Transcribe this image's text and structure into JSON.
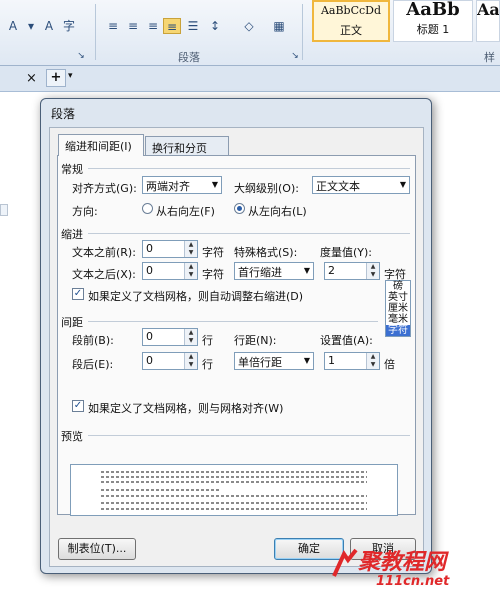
{
  "ribbon": {
    "paragraph_group_label": "段落",
    "style_gallery": [
      {
        "sample": "AaBbCcDd",
        "name": "正文",
        "active": true
      },
      {
        "sample": "AaBb",
        "name": "标题 1",
        "active": false
      },
      {
        "sample": "Aa",
        "name": "",
        "active": false
      }
    ],
    "styles_group_label": "样式"
  },
  "tabstrip": {
    "close": "×",
    "new_tab": "+"
  },
  "dialog": {
    "title": "段落",
    "tabs": [
      {
        "label": "缩进和间距(I)",
        "active": true
      },
      {
        "label": "换行和分页(P)",
        "active": false
      }
    ],
    "general": {
      "section_title": "常规",
      "alignment_label": "对齐方式(G):",
      "alignment_value": "两端对齐",
      "outline_label": "大纲级别(O):",
      "outline_value": "正文文本",
      "direction_label": "方向:",
      "direction_rtl": "从右向左(F)",
      "direction_ltr": "从左向右(L)"
    },
    "indent": {
      "section_title": "缩进",
      "before_label": "文本之前(R):",
      "before_value": "0",
      "before_unit": "字符",
      "after_label": "文本之后(X):",
      "after_value": "0",
      "after_unit": "字符",
      "special_label": "特殊格式(S):",
      "special_value": "首行缩进",
      "measure_label": "度量值(Y):",
      "measure_value": "2",
      "measure_unit": "字符",
      "grid_check_label": "如果定义了文档网格，则自动调整右缩进(D)"
    },
    "unit_options": [
      "磅",
      "英寸",
      "厘米",
      "毫米",
      "字符"
    ],
    "unit_selected": "字符",
    "spacing": {
      "section_title": "间距",
      "before_label": "段前(B):",
      "before_value": "0",
      "before_unit": "行",
      "after_label": "段后(E):",
      "after_value": "0",
      "after_unit": "行",
      "line_label": "行距(N):",
      "line_value": "单倍行距",
      "set_label": "设置值(A):",
      "set_value": "1",
      "set_unit": "倍",
      "grid_check_label": "如果定义了文档网格，则与网格对齐(W)"
    },
    "preview_title": "预览",
    "buttons": {
      "tabs": "制表位(T)...",
      "ok": "确定",
      "cancel": "取消"
    }
  },
  "watermark": {
    "line1": "聚教程网",
    "line2": "111cn.net"
  }
}
